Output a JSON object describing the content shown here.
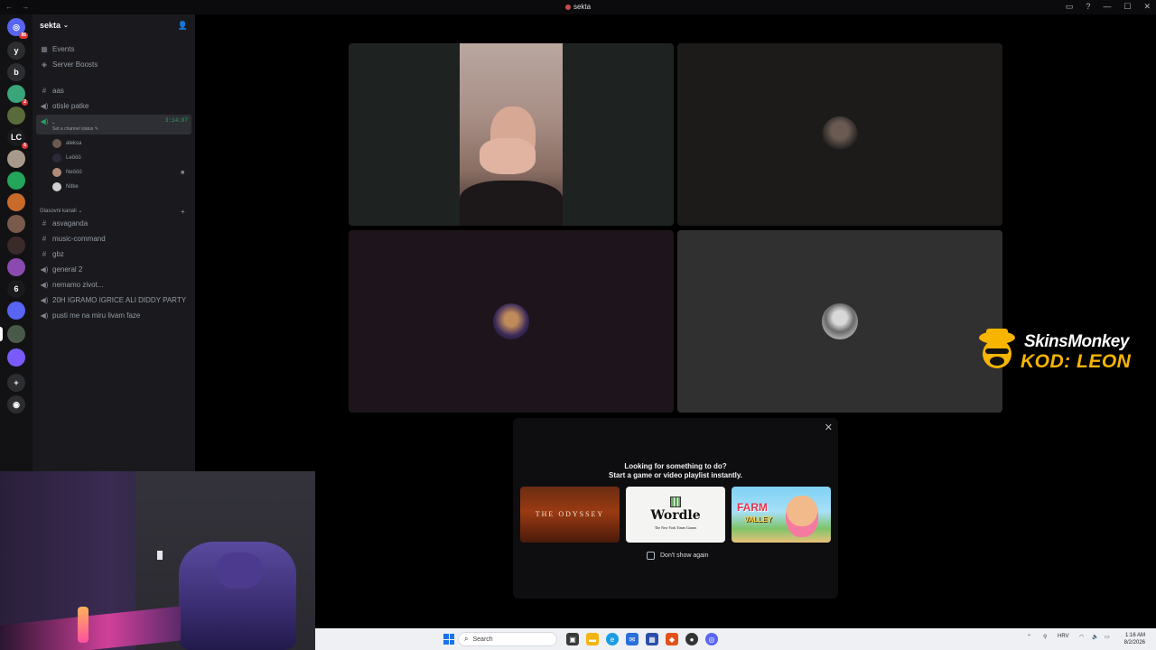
{
  "window": {
    "title": "sekta",
    "nav": "← →"
  },
  "rail": {
    "home_badge": "86",
    "servers": [
      {
        "label": "y",
        "color": "#2b2d31"
      },
      {
        "label": "b",
        "color": "#2b2d31"
      },
      {
        "label": "",
        "color": "#3aa57a",
        "badge": "2"
      },
      {
        "label": "",
        "color": "#5a6a3a"
      },
      {
        "label": "LC",
        "color": "#1a1a1e",
        "badge": "6"
      },
      {
        "label": "",
        "color": "#a89a8a"
      },
      {
        "label": "",
        "color": "#23a55a"
      },
      {
        "label": "",
        "color": "#c86a2a"
      },
      {
        "label": "",
        "color": "#7a5a4a"
      },
      {
        "label": "",
        "color": "#3a2a2a"
      },
      {
        "label": "",
        "color": "#8a4ab0"
      },
      {
        "label": "6",
        "color": "#1a1a1e"
      },
      {
        "label": "",
        "color": "#5865f2"
      },
      {
        "label": "",
        "color": "#4a5a4a"
      },
      {
        "label": "",
        "color": "#7a5af8"
      }
    ]
  },
  "sidebar": {
    "server_name": "sekta",
    "events": "Events",
    "server_boosts": "Server Boosts",
    "channels_top": [
      {
        "icon": "#",
        "label": "aas"
      },
      {
        "icon": "◀)",
        "label": "otisle patke"
      }
    ],
    "active_voice": {
      "label": ".",
      "timer": "3:14:07",
      "status": "Set a channel status"
    },
    "voice_users": [
      {
        "name": "aleksa",
        "color": "#6b5a50"
      },
      {
        "name": "Leööö",
        "color": "#2a2a3a"
      },
      {
        "name": "Neööö",
        "color": "#b08a7a",
        "camera": true
      },
      {
        "name": "Nitke",
        "color": "#d0d0d0"
      }
    ],
    "category": "Glasovni kanali",
    "channels_bottom": [
      {
        "icon": "#",
        "label": "asvaganda"
      },
      {
        "icon": "#",
        "label": "music-command"
      },
      {
        "icon": "#",
        "label": "gbz"
      },
      {
        "icon": "◀)",
        "label": "general 2"
      },
      {
        "icon": "◀)",
        "label": "nemamo zivot..."
      },
      {
        "icon": "◀)",
        "label": "20H IGRAMO IGRICE ALI DIDDY PARTY"
      },
      {
        "icon": "◀)",
        "label": "pusti me na miru livam faze"
      }
    ]
  },
  "popup": {
    "line1": "Looking for something to do?",
    "line2": "Start a game or video playlist instantly.",
    "cards": {
      "odyssey": "THE ODYSSEY",
      "wordle": "Wordle",
      "wordle_sub": "The New York Times Games",
      "farm": "FARM",
      "farm2": "VALLEY"
    },
    "dont_show": "Don't show again"
  },
  "brand": {
    "name": "SkinsMonkey",
    "code": "KOD: LEON"
  },
  "taskbar": {
    "search": "Search",
    "lang": "HRV",
    "time": "1:16 AM",
    "date": "8/2/2026"
  }
}
